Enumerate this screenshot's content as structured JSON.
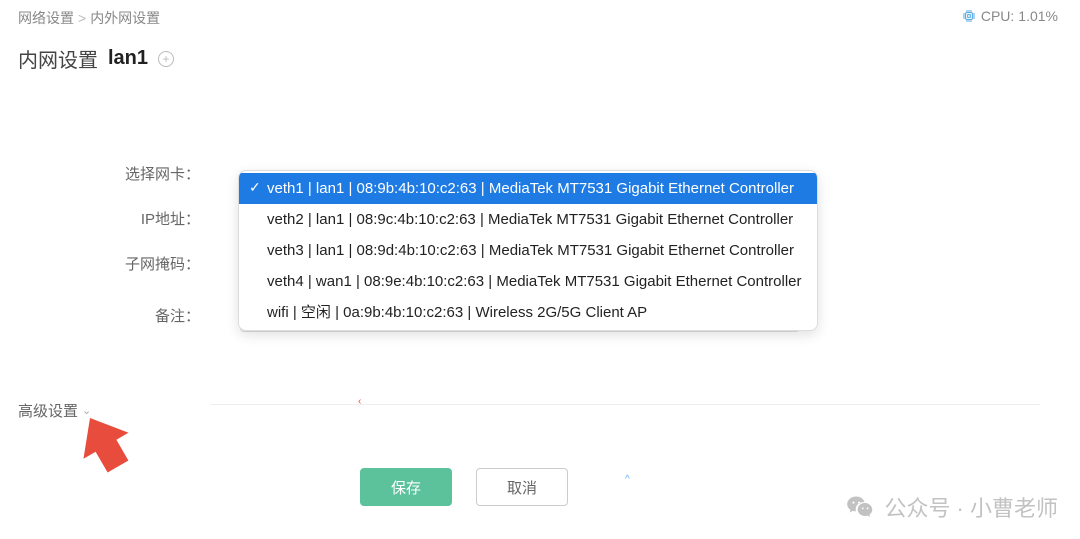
{
  "breadcrumb": {
    "parent": "网络设置",
    "current": "内外网设置",
    "sep": ">"
  },
  "cpu": {
    "label": "CPU:",
    "value": "1.01%"
  },
  "header": {
    "title": "内网设置",
    "iface": "lan1"
  },
  "form": {
    "nic_label": "选择网卡：",
    "ip_label": "IP地址：",
    "mask_label": "子网掩码：",
    "note_label": "备注：",
    "note_value": ""
  },
  "dropdown": {
    "items": [
      "veth1 | lan1 | 08:9b:4b:10:c2:63 | MediaTek MT7531 Gigabit Ethernet Controller",
      "veth2 | lan1 | 08:9c:4b:10:c2:63 | MediaTek MT7531 Gigabit Ethernet Controller",
      "veth3 | lan1 | 08:9d:4b:10:c2:63 | MediaTek MT7531 Gigabit Ethernet Controller",
      "veth4 | wan1 | 08:9e:4b:10:c2:63 | MediaTek MT7531 Gigabit Ethernet Controller",
      "wifi | 空闲 | 0a:9b:4b:10:c2:63 | Wireless 2G/5G Client AP"
    ],
    "selected_index": 0
  },
  "advanced": {
    "label": "高级设置"
  },
  "actions": {
    "save": "保存",
    "cancel": "取消"
  },
  "watermark": {
    "text": "公众号 · 小曹老师"
  },
  "colors": {
    "accent_blue": "#1e7be4",
    "save_green": "#5bc29c",
    "cpu_blue": "#4aa3e0"
  }
}
